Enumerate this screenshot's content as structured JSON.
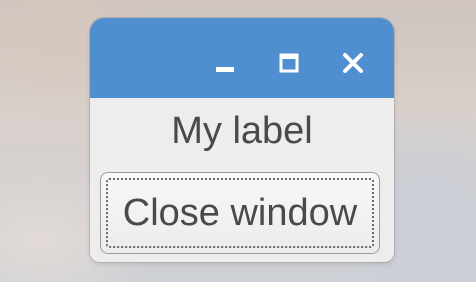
{
  "window": {
    "titlebar_color": "#4f8fcf",
    "controls": {
      "minimize_icon": "minimize-icon",
      "maximize_icon": "maximize-icon",
      "close_icon": "close-icon"
    }
  },
  "content": {
    "label_text": "My label",
    "button_label": "Close window"
  }
}
